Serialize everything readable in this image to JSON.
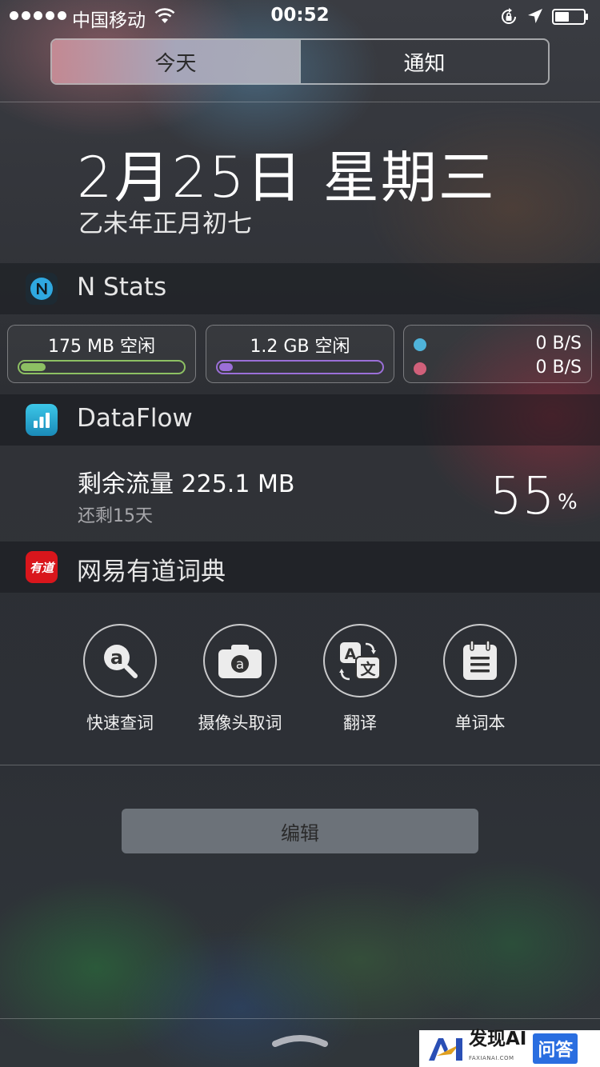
{
  "status_bar": {
    "carrier": "中国移动",
    "time": "00:52"
  },
  "segmented": {
    "today": "今天",
    "notifications": "通知"
  },
  "date": {
    "main": "2月25日 星期三",
    "lunar": "乙未年正月初七"
  },
  "nstats": {
    "title": "N Stats",
    "memory_label": "175 MB 空闲",
    "memory_fill": 0.17,
    "storage_label": "1.2 GB 空闲",
    "storage_fill": 0.1,
    "net_up": "0 B/S",
    "net_down": "0 B/S",
    "colors": {
      "memory": "#8dc063",
      "storage": "#9b6fd8",
      "up": "#4fb3d9",
      "down": "#d0607a"
    }
  },
  "dataflow": {
    "title": "DataFlow",
    "remaining": "剩余流量 225.1 MB",
    "days_left": "还剩15天",
    "percent": "55",
    "percent_sign": "%"
  },
  "youdao": {
    "title": "网易有道词典",
    "icon_text": "有道",
    "actions": [
      {
        "label": "快速查词",
        "icon": "magnifier-at-icon"
      },
      {
        "label": "摄像头取词",
        "icon": "camera-icon"
      },
      {
        "label": "翻译",
        "icon": "translate-icon"
      },
      {
        "label": "单词本",
        "icon": "notebook-icon"
      }
    ]
  },
  "edit_button": "编辑",
  "watermark": {
    "brand": "发现AI",
    "domain": "FAXIANAI.COM",
    "tag": "问答"
  }
}
